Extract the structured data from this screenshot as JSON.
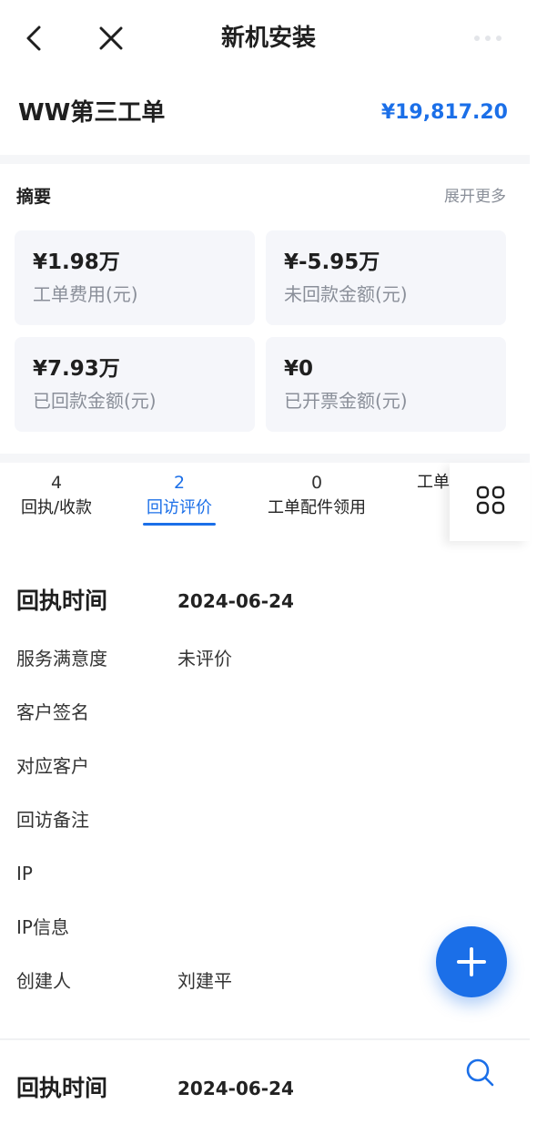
{
  "nav": {
    "title": "新机安装",
    "back_icon": "chevron-left-icon",
    "close_icon": "close-icon",
    "more_icon": "more-dots-icon"
  },
  "order": {
    "name": "WW第三工单",
    "amount": "¥19,817.20"
  },
  "summary": {
    "title": "摘要",
    "expand_label": "展开更多",
    "cards": [
      {
        "value": "¥1.98万",
        "label": "工单费用(元)"
      },
      {
        "value": "¥-5.95万",
        "label": "未回款金额(元)"
      },
      {
        "value": "¥7.93万",
        "label": "已回款金额(元)"
      },
      {
        "value": "¥0",
        "label": "已开票金额(元)"
      }
    ]
  },
  "tabs": [
    {
      "count": "4",
      "label": "回执/收款",
      "active": false
    },
    {
      "count": "2",
      "label": "回访评价",
      "active": true
    },
    {
      "count": "0",
      "label": "工单配件领用",
      "active": false
    },
    {
      "count": "",
      "label": "工单",
      "active": false
    }
  ],
  "records": [
    {
      "head_label": "回执时间",
      "head_value": "2024-06-24",
      "fields": [
        {
          "label": "服务满意度",
          "value": "未评价"
        },
        {
          "label": "客户签名",
          "value": ""
        },
        {
          "label": "对应客户",
          "value": ""
        },
        {
          "label": "回访备注",
          "value": ""
        },
        {
          "label": "IP",
          "value": ""
        },
        {
          "label": "IP信息",
          "value": ""
        },
        {
          "label": "创建人",
          "value": "刘建平"
        }
      ]
    },
    {
      "head_label": "回执时间",
      "head_value": "2024-06-24",
      "fields": []
    }
  ],
  "colors": {
    "accent": "#1b6fe8",
    "card_bg": "#f5f6fa",
    "muted_text": "#8a8f99"
  },
  "fab_icon": "plus-icon",
  "search_icon": "search-icon",
  "grid_icon": "grid-icon"
}
